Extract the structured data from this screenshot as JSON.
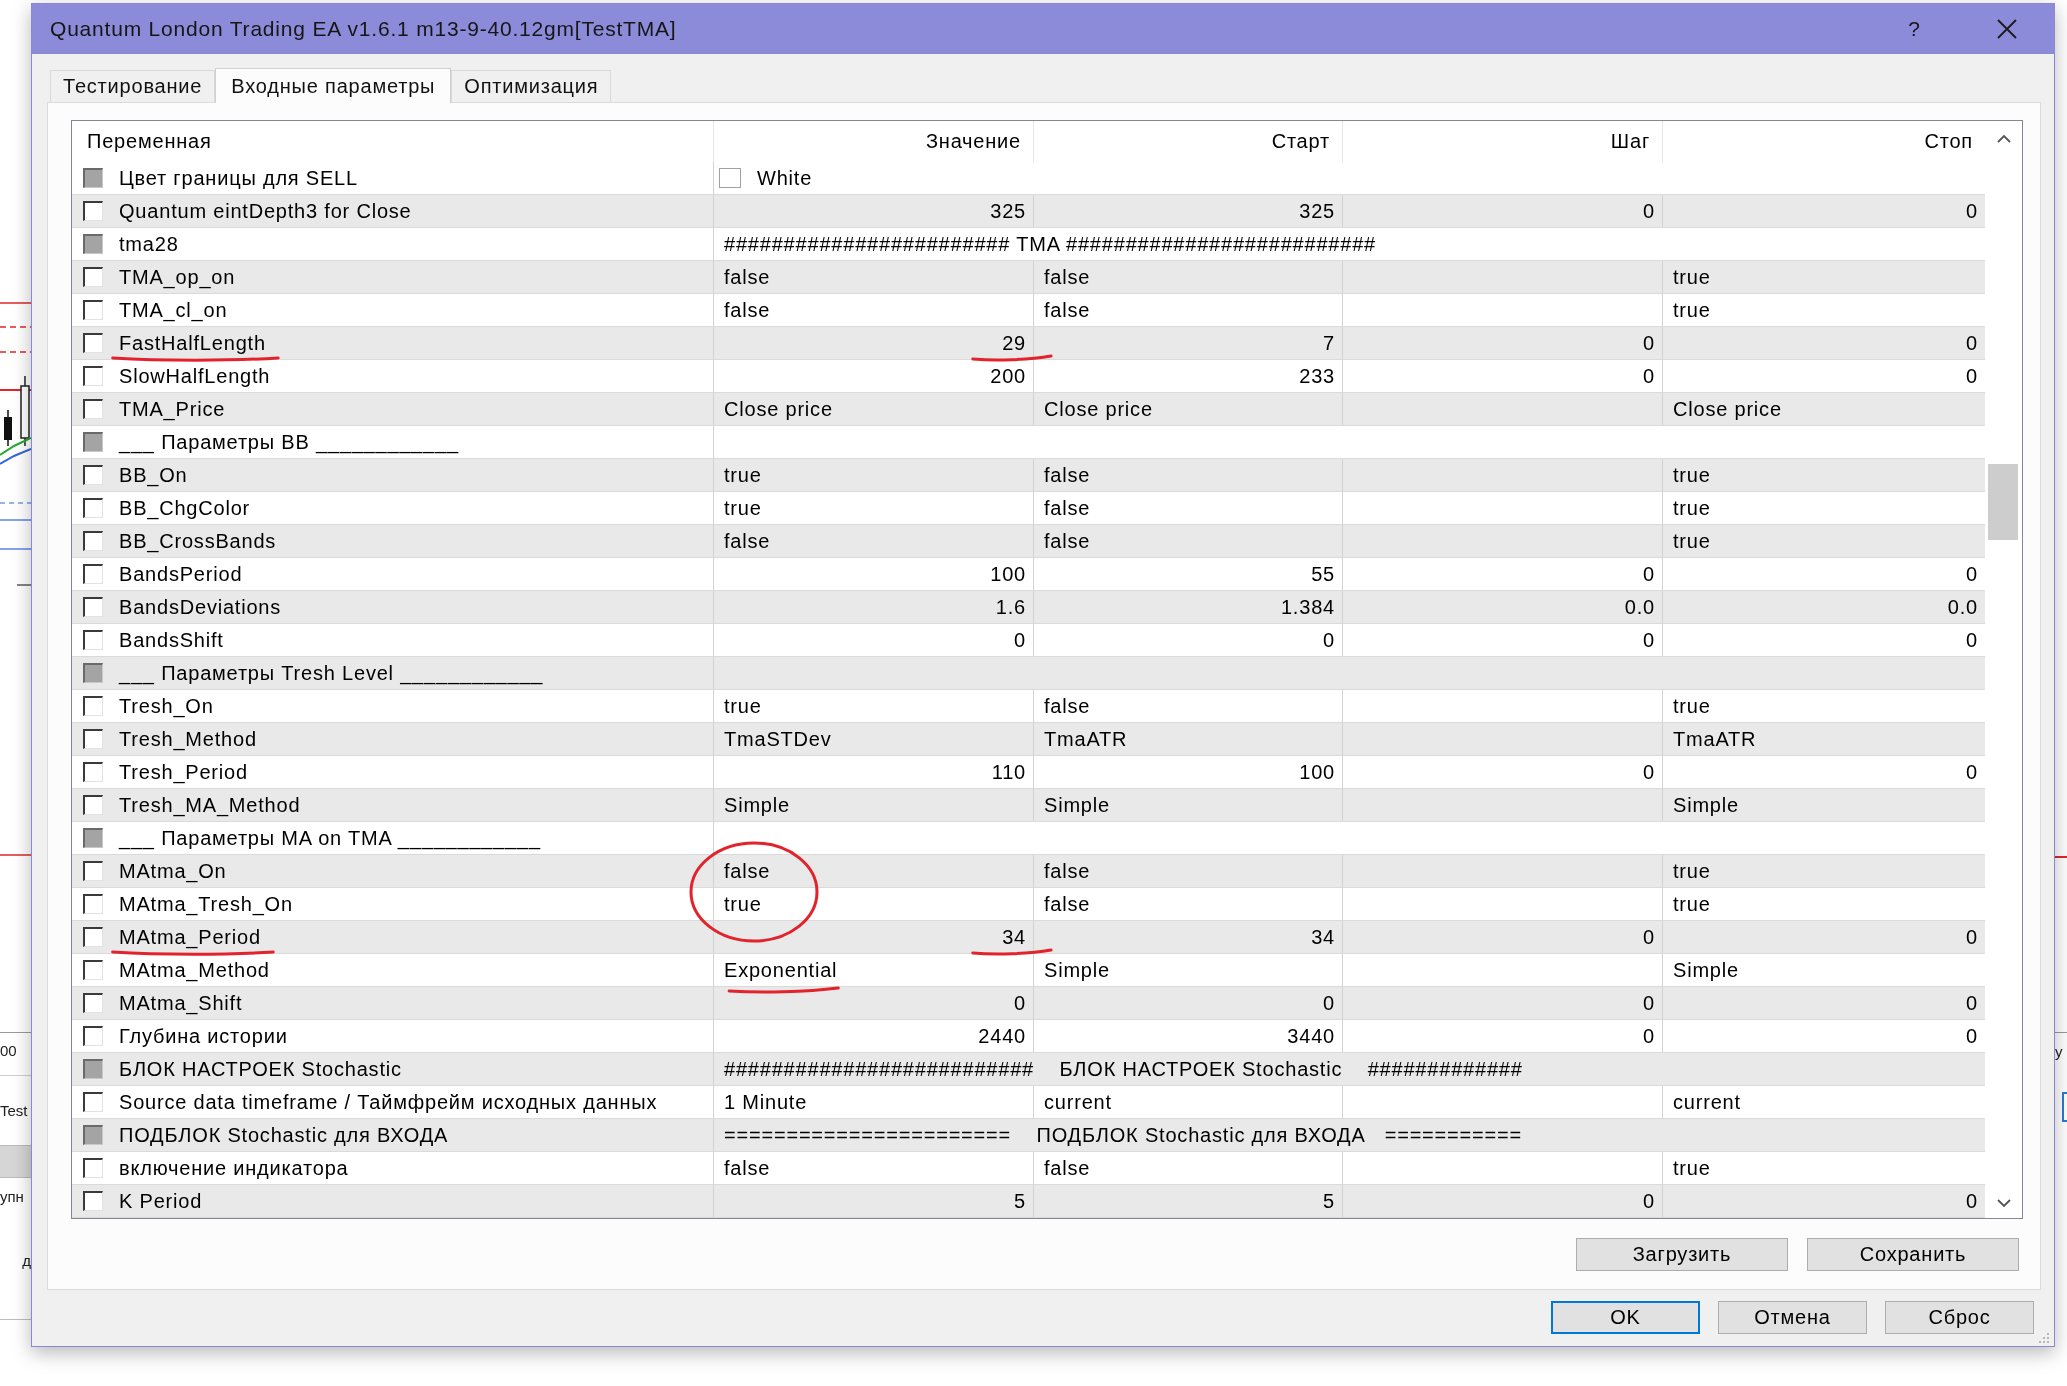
{
  "background": {
    "left_texts": [
      "00",
      "Test",
      "упн",
      "д"
    ],
    "right_texts": [
      "у"
    ]
  },
  "window": {
    "title": "Quantum London Trading EA v1.6.1 m13-9-40.12gm[TestTMA]",
    "help": "?"
  },
  "tabs": [
    {
      "label": "Тестирование",
      "selected": false
    },
    {
      "label": "Входные параметры",
      "selected": true
    },
    {
      "label": "Оптимизация",
      "selected": false
    }
  ],
  "table": {
    "columns": [
      "Переменная",
      "Значение",
      "Старт",
      "Шаг",
      "Стоп"
    ],
    "rows": [
      {
        "kind": "color",
        "name": "Цвет границы для SELL",
        "checked": false,
        "disabled": true,
        "value": "White",
        "color": "#ffffff"
      },
      {
        "kind": "number",
        "name": "Quantum eintDepth3 for Close",
        "checked": false,
        "disabled": false,
        "value": "325",
        "start": "325",
        "step": "0",
        "stop": "0"
      },
      {
        "kind": "group",
        "name": "tma28",
        "checked": false,
        "disabled": true,
        "value": "######################## TMA ##########################"
      },
      {
        "kind": "text",
        "name": "TMA_op_on",
        "checked": false,
        "disabled": false,
        "value": "false",
        "start": "false",
        "stop": "true"
      },
      {
        "kind": "text",
        "name": "TMA_cl_on",
        "checked": false,
        "disabled": false,
        "value": "false",
        "start": "false",
        "stop": "true"
      },
      {
        "kind": "number",
        "name": "FastHalfLength",
        "checked": false,
        "disabled": false,
        "value": "29",
        "start": "7",
        "step": "0",
        "stop": "0",
        "name_underlined": true,
        "value_underlined": true
      },
      {
        "kind": "number",
        "name": "SlowHalfLength",
        "checked": false,
        "disabled": false,
        "value": "200",
        "start": "233",
        "step": "0",
        "stop": "0"
      },
      {
        "kind": "text",
        "name": "TMA_Price",
        "checked": false,
        "disabled": false,
        "value": "Close price",
        "start": "Close price",
        "stop": "Close price"
      },
      {
        "kind": "group",
        "name": "___ Параметры BB ____________",
        "checked": false,
        "disabled": true
      },
      {
        "kind": "text",
        "name": "BB_On",
        "checked": false,
        "disabled": false,
        "value": "true",
        "start": "false",
        "stop": "true"
      },
      {
        "kind": "text",
        "name": "BB_ChgColor",
        "checked": false,
        "disabled": false,
        "value": "true",
        "start": "false",
        "stop": "true"
      },
      {
        "kind": "text",
        "name": "BB_CrossBands",
        "checked": false,
        "disabled": false,
        "value": "false",
        "start": "false",
        "stop": "true"
      },
      {
        "kind": "number",
        "name": "BandsPeriod",
        "checked": false,
        "disabled": false,
        "value": "100",
        "start": "55",
        "step": "0",
        "stop": "0"
      },
      {
        "kind": "number",
        "name": "BandsDeviations",
        "checked": false,
        "disabled": false,
        "value": "1.6",
        "start": "1.384",
        "step": "0.0",
        "stop": "0.0"
      },
      {
        "kind": "number",
        "name": "BandsShift",
        "checked": false,
        "disabled": false,
        "value": "0",
        "start": "0",
        "step": "0",
        "stop": "0"
      },
      {
        "kind": "group",
        "name": "___ Параметры Tresh Level ____________",
        "checked": false,
        "disabled": true
      },
      {
        "kind": "text",
        "name": "Tresh_On",
        "checked": false,
        "disabled": false,
        "value": "true",
        "start": "false",
        "stop": "true"
      },
      {
        "kind": "text",
        "name": "Tresh_Method",
        "checked": false,
        "disabled": false,
        "value": "TmaSTDev",
        "start": "TmaATR",
        "stop": "TmaATR"
      },
      {
        "kind": "number",
        "name": "Tresh_Period",
        "checked": false,
        "disabled": false,
        "value": "110",
        "start": "100",
        "step": "0",
        "stop": "0"
      },
      {
        "kind": "text",
        "name": "Tresh_MA_Method",
        "checked": false,
        "disabled": false,
        "value": "Simple",
        "start": "Simple",
        "stop": "Simple"
      },
      {
        "kind": "group",
        "name": "___ Параметры MA on TMA ____________",
        "checked": false,
        "disabled": true
      },
      {
        "kind": "text",
        "name": "MAtma_On",
        "checked": false,
        "disabled": false,
        "value": "false",
        "start": "false",
        "stop": "true",
        "value_circled": true
      },
      {
        "kind": "text",
        "name": "MAtma_Tresh_On",
        "checked": false,
        "disabled": false,
        "value": "true",
        "start": "false",
        "stop": "true",
        "value_circled": true
      },
      {
        "kind": "number",
        "name": "MAtma_Period",
        "checked": false,
        "disabled": false,
        "value": "34",
        "start": "34",
        "step": "0",
        "stop": "0",
        "name_underlined": true,
        "value_underlined": true
      },
      {
        "kind": "text",
        "name": "MAtma_Method",
        "checked": false,
        "disabled": false,
        "value": "Exponential",
        "start": "Simple",
        "stop": "Simple",
        "value_underlined": true
      },
      {
        "kind": "number",
        "name": "MAtma_Shift",
        "checked": false,
        "disabled": false,
        "value": "0",
        "start": "0",
        "step": "0",
        "stop": "0"
      },
      {
        "kind": "number",
        "name": "Глубина истории",
        "checked": false,
        "disabled": false,
        "value": "2440",
        "start": "3440",
        "step": "0",
        "stop": "0"
      },
      {
        "kind": "group",
        "name": "БЛОК НАСТРОЕК Stochastic",
        "checked": false,
        "disabled": true,
        "value": "##########################    БЛОК НАСТРОЕК Stochastic    #############"
      },
      {
        "kind": "text",
        "name": "Source data timeframe / Таймфрейм исходных данных",
        "checked": false,
        "disabled": false,
        "value": "1 Minute",
        "start": "current",
        "stop": "current"
      },
      {
        "kind": "group",
        "name": "ПОДБЛОК Stochastic для ВХОДА",
        "checked": false,
        "disabled": true,
        "value": "=======================    ПОДБЛОК Stochastic для ВХОДА   ==========="
      },
      {
        "kind": "text",
        "name": "включение индикатора",
        "checked": false,
        "disabled": false,
        "value": "false",
        "start": "false",
        "stop": "true"
      },
      {
        "kind": "number",
        "name": "K Period",
        "checked": false,
        "disabled": false,
        "value": "5",
        "start": "5",
        "step": "0",
        "stop": "0"
      }
    ]
  },
  "panel_buttons": [
    "Загрузить",
    "Сохранить"
  ],
  "buttons": [
    {
      "label": "OK",
      "default": true
    },
    {
      "label": "Отмена",
      "default": false
    },
    {
      "label": "Сброс",
      "default": false
    }
  ]
}
